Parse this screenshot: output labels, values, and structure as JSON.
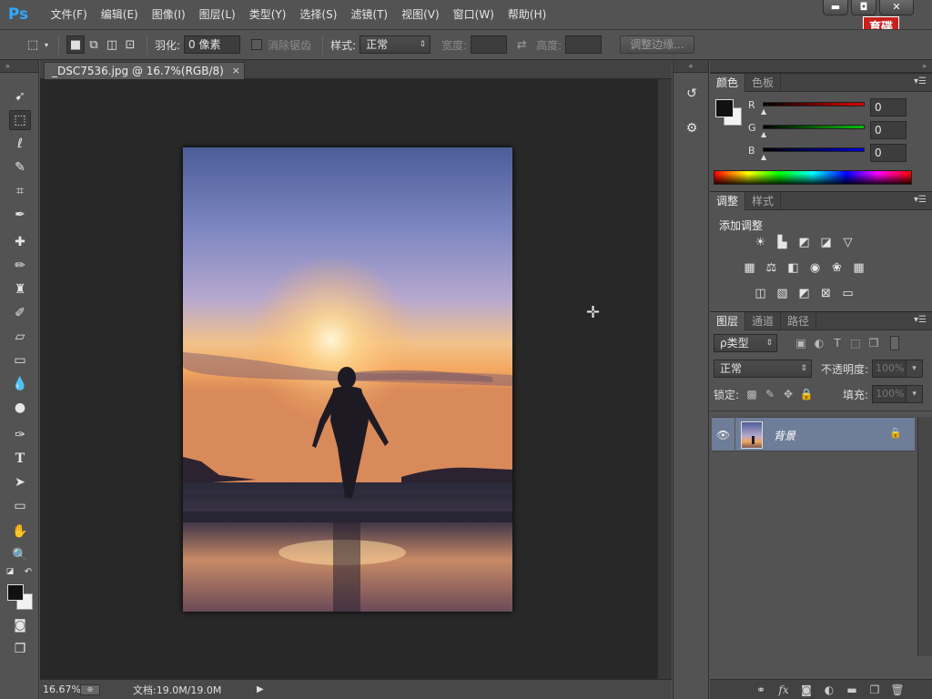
{
  "app": {
    "logo": "Ps"
  },
  "menu": [
    "文件(F)",
    "编辑(E)",
    "图像(I)",
    "图层(L)",
    "类型(Y)",
    "选择(S)",
    "滤镜(T)",
    "视图(V)",
    "窗口(W)",
    "帮助(H)"
  ],
  "window_controls": {
    "minimize": "▬",
    "restore": "◘",
    "close": "✕"
  },
  "watermark": {
    "line1": "育碟",
    "line2": "软件"
  },
  "options": {
    "feather_label": "羽化:",
    "feather_value": "0 像素",
    "antialias_label": "消除锯齿",
    "style_label": "样式:",
    "style_value": "正常",
    "width_label": "宽度:",
    "height_label": "高度:",
    "refine_edge": "调整边缘..."
  },
  "document": {
    "tab_title": "_DSC7536.jpg @ 16.7%(RGB/8)",
    "close": "×",
    "zoom": "16.67%",
    "doc_info": "文档:19.0M/19.0M"
  },
  "panels": {
    "color": {
      "tabs": [
        "颜色",
        "色板"
      ],
      "r_label": "R",
      "g_label": "G",
      "b_label": "B",
      "r_value": "0",
      "g_value": "0",
      "b_value": "0"
    },
    "adjustments": {
      "tabs": [
        "调整",
        "样式"
      ],
      "title": "添加调整"
    },
    "layers": {
      "tabs": [
        "图层",
        "通道",
        "路径"
      ],
      "kind_filter": "ρ类型",
      "blend_mode": "正常",
      "opacity_label": "不透明度:",
      "opacity_value": "100%",
      "lock_label": "锁定:",
      "fill_label": "填充:",
      "fill_value": "100%",
      "layer_name": "背景"
    }
  },
  "colors": {
    "accent": "#31a8ff",
    "layer_selected": "#6e7d98",
    "red_bar": "#e00000",
    "green_bar": "#00c000",
    "blue_bar": "#0000d0"
  }
}
